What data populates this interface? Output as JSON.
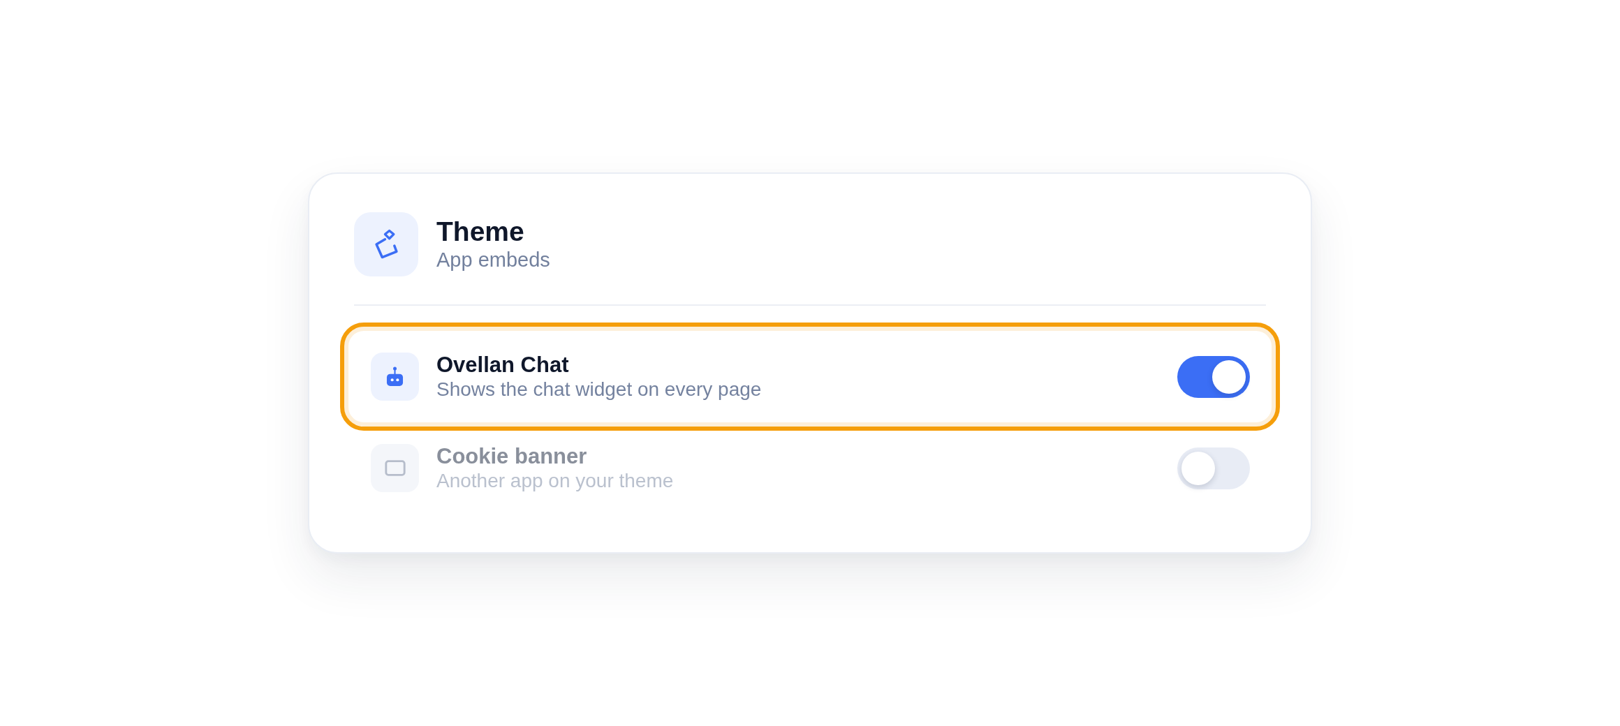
{
  "header": {
    "title": "Theme",
    "subtitle": "App embeds"
  },
  "rows": [
    {
      "kind": "chat",
      "title": "Ovellan Chat",
      "description": "Shows the chat widget on every page",
      "on": true,
      "disabled": false,
      "highlighted": true
    },
    {
      "kind": "banner",
      "title": "Cookie banner",
      "description": "Another app on your theme",
      "on": false,
      "disabled": true,
      "highlighted": false
    }
  ]
}
